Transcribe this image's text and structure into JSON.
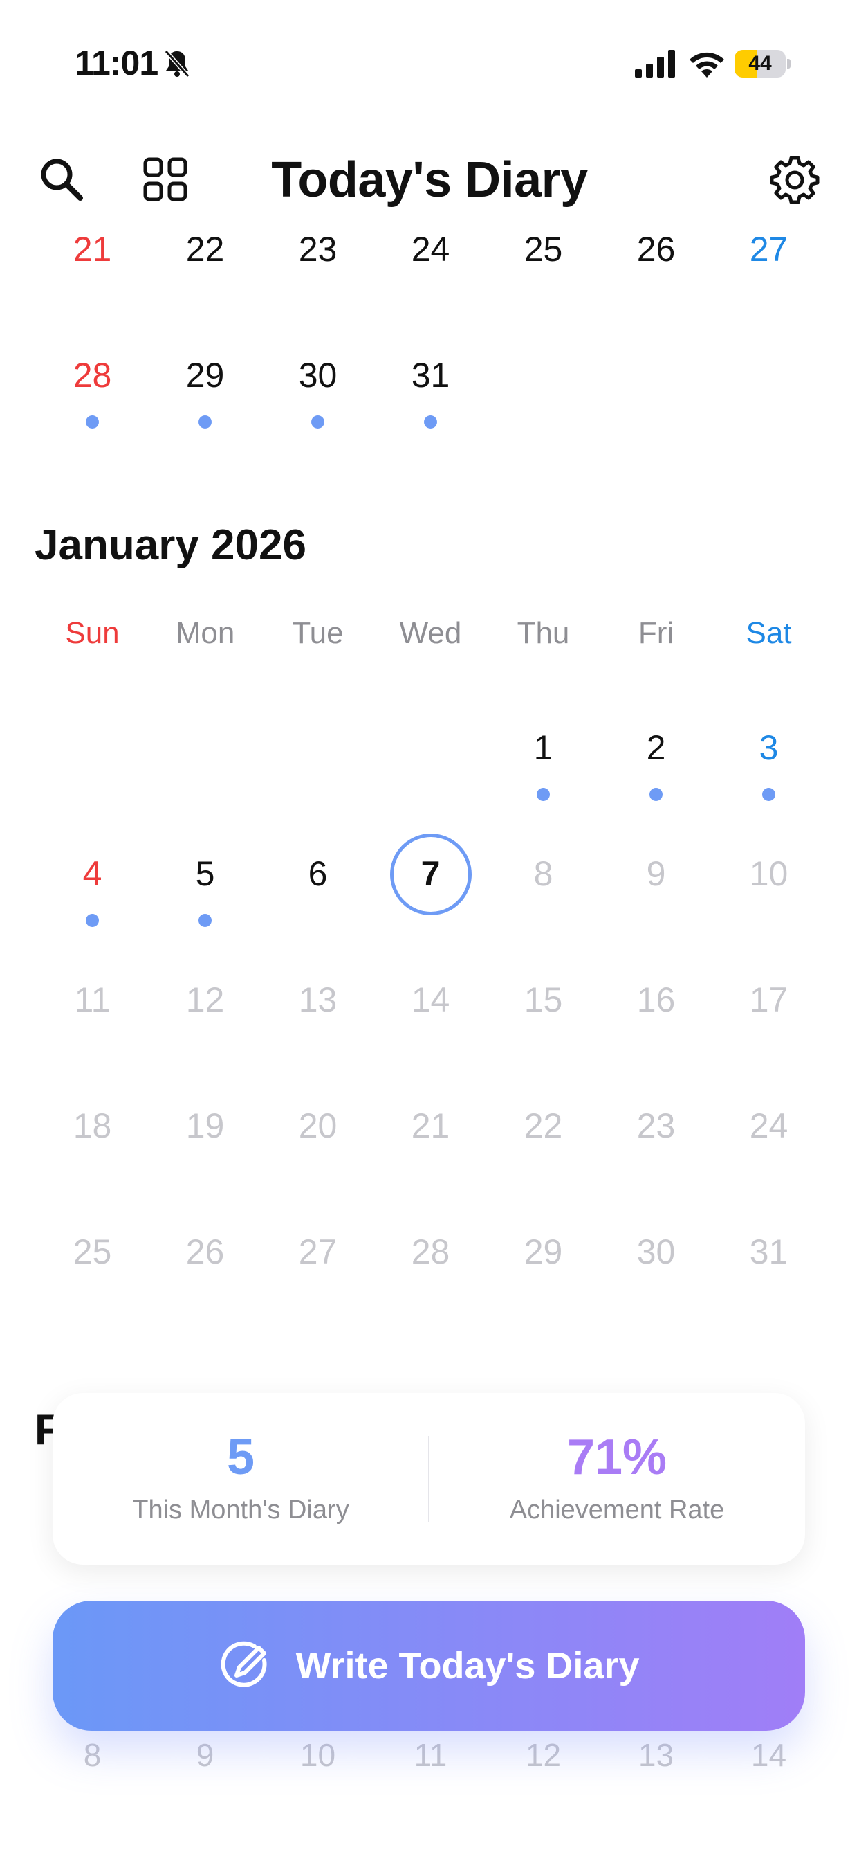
{
  "status_bar": {
    "time": "11:01",
    "battery_level": "44",
    "battery_fraction": 0.44
  },
  "header": {
    "title": "Today's Diary",
    "left_icons": [
      "search-icon",
      "grid-icon"
    ],
    "right_icon": "gear-icon"
  },
  "previous_month": {
    "rows": [
      [
        {
          "day": "21",
          "kind": "sun",
          "dot": false
        },
        {
          "day": "22",
          "kind": "",
          "dot": false
        },
        {
          "day": "23",
          "kind": "",
          "dot": false
        },
        {
          "day": "24",
          "kind": "",
          "dot": false
        },
        {
          "day": "25",
          "kind": "",
          "dot": false
        },
        {
          "day": "26",
          "kind": "",
          "dot": false
        },
        {
          "day": "27",
          "kind": "sat",
          "dot": false
        }
      ],
      [
        {
          "day": "28",
          "kind": "sun",
          "dot": true
        },
        {
          "day": "29",
          "kind": "",
          "dot": true
        },
        {
          "day": "30",
          "kind": "",
          "dot": true
        },
        {
          "day": "31",
          "kind": "",
          "dot": true
        },
        {
          "day": "",
          "kind": "",
          "dot": false
        },
        {
          "day": "",
          "kind": "",
          "dot": false
        },
        {
          "day": "",
          "kind": "",
          "dot": false
        }
      ]
    ]
  },
  "current_month": {
    "title": "January 2026",
    "weekdays": [
      "Sun",
      "Mon",
      "Tue",
      "Wed",
      "Thu",
      "Fri",
      "Sat"
    ],
    "rows": [
      [
        {
          "day": "",
          "kind": "",
          "dot": false
        },
        {
          "day": "",
          "kind": "",
          "dot": false
        },
        {
          "day": "",
          "kind": "",
          "dot": false
        },
        {
          "day": "",
          "kind": "",
          "dot": false
        },
        {
          "day": "1",
          "kind": "",
          "dot": true
        },
        {
          "day": "2",
          "kind": "",
          "dot": true
        },
        {
          "day": "3",
          "kind": "sat",
          "dot": true
        }
      ],
      [
        {
          "day": "4",
          "kind": "sun",
          "dot": true
        },
        {
          "day": "5",
          "kind": "",
          "dot": true
        },
        {
          "day": "6",
          "kind": "",
          "dot": false
        },
        {
          "day": "7",
          "kind": "today",
          "dot": false
        },
        {
          "day": "8",
          "kind": "future",
          "dot": false
        },
        {
          "day": "9",
          "kind": "future",
          "dot": false
        },
        {
          "day": "10",
          "kind": "future",
          "dot": false
        }
      ],
      [
        {
          "day": "11",
          "kind": "future",
          "dot": false
        },
        {
          "day": "12",
          "kind": "future",
          "dot": false
        },
        {
          "day": "13",
          "kind": "future",
          "dot": false
        },
        {
          "day": "14",
          "kind": "future",
          "dot": false
        },
        {
          "day": "15",
          "kind": "future",
          "dot": false
        },
        {
          "day": "16",
          "kind": "future",
          "dot": false
        },
        {
          "day": "17",
          "kind": "future",
          "dot": false
        }
      ],
      [
        {
          "day": "18",
          "kind": "future",
          "dot": false
        },
        {
          "day": "19",
          "kind": "future",
          "dot": false
        },
        {
          "day": "20",
          "kind": "future",
          "dot": false
        },
        {
          "day": "21",
          "kind": "future",
          "dot": false
        },
        {
          "day": "22",
          "kind": "future",
          "dot": false
        },
        {
          "day": "23",
          "kind": "future",
          "dot": false
        },
        {
          "day": "24",
          "kind": "future",
          "dot": false
        }
      ],
      [
        {
          "day": "25",
          "kind": "future",
          "dot": false
        },
        {
          "day": "26",
          "kind": "future",
          "dot": false
        },
        {
          "day": "27",
          "kind": "future",
          "dot": false
        },
        {
          "day": "28",
          "kind": "future",
          "dot": false
        },
        {
          "day": "29",
          "kind": "future",
          "dot": false
        },
        {
          "day": "30",
          "kind": "future",
          "dot": false
        },
        {
          "day": "31",
          "kind": "future",
          "dot": false
        }
      ]
    ]
  },
  "next_month": {
    "title_partial": "F",
    "visible_days": [
      "8",
      "9",
      "10",
      "11",
      "12",
      "13",
      "14"
    ]
  },
  "stats": {
    "month_count": "5",
    "month_label": "This Month's Diary",
    "achievement_value": "71%",
    "achievement_label": "Achievement Rate"
  },
  "write_button": {
    "label": "Write Today's Diary",
    "icon": "pencil-circle-icon"
  },
  "colors": {
    "accent_blue": "#6e9bf5",
    "accent_purple": "#a97cf5",
    "sunday_red": "#ee3b3b",
    "saturday_blue": "#1e88e5",
    "future_gray": "#c7c7cc"
  }
}
